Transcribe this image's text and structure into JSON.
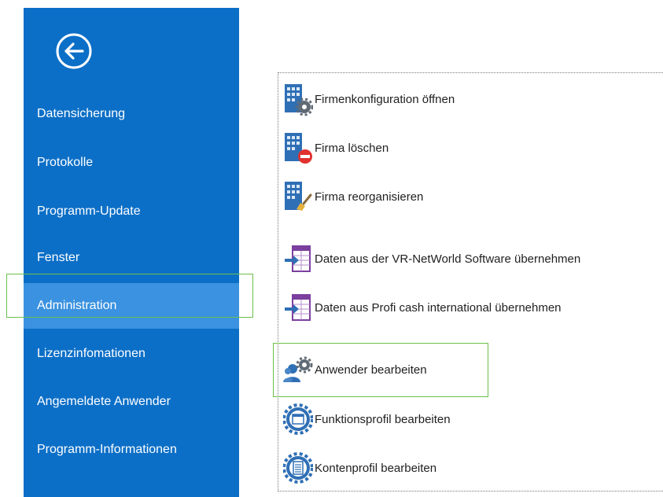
{
  "sidebar": {
    "back_icon": "back-arrow-circle-icon",
    "background": "#0c6fc7",
    "selected_background": "#3a92e0",
    "items": [
      {
        "label": "Datensicherung"
      },
      {
        "label": "Protokolle"
      },
      {
        "label": "Programm-Update"
      },
      {
        "label": "Fenster"
      },
      {
        "label": "Administration",
        "selected": true
      },
      {
        "label": "Lizenzinfomationen"
      },
      {
        "label": "Angemeldete Anwender"
      },
      {
        "label": "Programm-Informationen"
      }
    ]
  },
  "actions": [
    {
      "label": "Firmenkonfiguration öffnen",
      "icon": "building-gear-icon"
    },
    {
      "label": "Firma löschen",
      "icon": "building-delete-icon"
    },
    {
      "label": "Firma reorganisieren",
      "icon": "building-brush-icon"
    },
    {
      "label": "Daten aus der VR-NetWorld Software übernehmen",
      "icon": "import-table-icon"
    },
    {
      "label": "Daten aus Profi cash international übernehmen",
      "icon": "import-table-icon"
    },
    {
      "label": "Anwender bearbeiten",
      "icon": "users-gear-icon",
      "highlighted": true
    },
    {
      "label": "Funktionsprofil bearbeiten",
      "icon": "gear-window-icon"
    },
    {
      "label": "Kontenprofil bearbeiten",
      "icon": "gear-document-icon"
    }
  ],
  "colors": {
    "highlight_border": "#6bc04b",
    "icon_blue": "#2f6fb5",
    "icon_purple": "#7b3f9e"
  }
}
